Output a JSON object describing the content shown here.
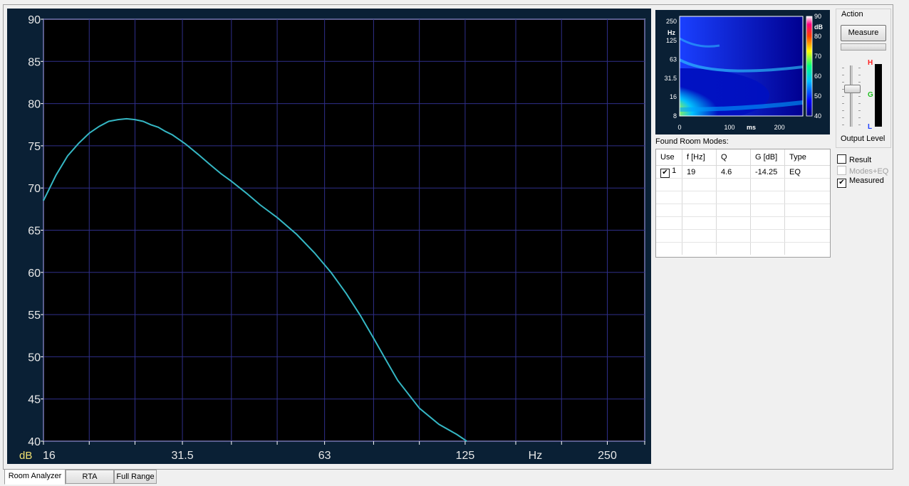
{
  "main_plot": {
    "y_axis_unit": "dB",
    "x_axis_unit": "Hz",
    "y_ticks": [
      "90",
      "85",
      "80",
      "75",
      "70",
      "65",
      "60",
      "55",
      "50",
      "45",
      "40"
    ],
    "x_tick_labels": [
      "16",
      "31.5",
      "63",
      "125",
      "250"
    ]
  },
  "chart_data": {
    "type": "line",
    "x_scale": "log",
    "xlim": [
      16,
      300
    ],
    "ylim": [
      40,
      90
    ],
    "xlabel": "Hz",
    "ylabel": "dB",
    "grid": true,
    "series": [
      {
        "color": "#35b7c4",
        "x": [
          16,
          17,
          18,
          19,
          20,
          21,
          22,
          23,
          24,
          25,
          26,
          27,
          28,
          29,
          30,
          32,
          34,
          36,
          38,
          40,
          43,
          46,
          50,
          55,
          60,
          65,
          70,
          75,
          80,
          85,
          90,
          100,
          110,
          120,
          126
        ],
        "y": [
          68.5,
          71.5,
          73.8,
          75.3,
          76.5,
          77.3,
          77.9,
          78.1,
          78.2,
          78.1,
          77.9,
          77.5,
          77.2,
          76.7,
          76.3,
          75.2,
          74.0,
          72.8,
          71.7,
          70.8,
          69.4,
          68.0,
          66.5,
          64.5,
          62.3,
          60.0,
          57.5,
          54.9,
          52.2,
          49.6,
          47.2,
          43.9,
          42.0,
          40.8,
          40.0
        ]
      }
    ]
  },
  "waterfall": {
    "y_unit": "Hz",
    "y_ticks": [
      "250",
      "125",
      "63",
      "31.5",
      "16",
      "8"
    ],
    "x_ticks": [
      "0",
      "100",
      "200"
    ],
    "x_unit": "ms",
    "colorbar_unit": "dB",
    "colorbar_ticks": [
      "90",
      "80",
      "70",
      "60",
      "50",
      "40"
    ]
  },
  "room_modes": {
    "title": "Found Room Modes:",
    "columns": [
      "Use",
      "f [Hz]",
      "Q",
      "G [dB]",
      "Type"
    ],
    "rows": [
      {
        "use": "1",
        "checked": true,
        "f": "19",
        "q": "4.6",
        "g": "-14.25",
        "type": "EQ"
      }
    ]
  },
  "action": {
    "title": "Action",
    "measure_label": "Measure",
    "output_level_label": "Output Level",
    "meter_high": "H",
    "meter_good": "G",
    "meter_low": "L",
    "level_fraction": 0.25
  },
  "options": {
    "result_label": "Result",
    "result_checked": false,
    "modes_eq_label": "Modes+EQ",
    "modes_eq_checked": false,
    "modes_eq_disabled": true,
    "measured_label": "Measured",
    "measured_checked": true
  },
  "tabs": [
    {
      "label": "Room Analyzer",
      "active": true
    },
    {
      "label": "RTA",
      "active": false
    },
    {
      "label": "Full Range",
      "active": false
    }
  ],
  "colors": {
    "plot_bg": "#000000",
    "panel_bg": "#0a2035",
    "grid": "#2f2f8a",
    "curve": "#35b7c4",
    "axis_text": "#e8e8e8",
    "unit_text": "#f0e070"
  }
}
